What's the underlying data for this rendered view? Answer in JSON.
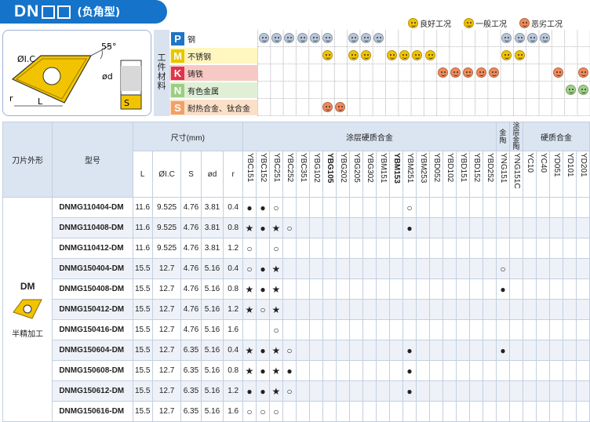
{
  "header": {
    "code": "DN",
    "subtitle": "(负角型)"
  },
  "legend": [
    {
      "label": "良好工况",
      "icon": "face-good"
    },
    {
      "label": "一般工况",
      "icon": "face-neutral"
    },
    {
      "label": "恶劣工况",
      "icon": "face-bad"
    }
  ],
  "diagram": {
    "angle": "55°",
    "ic": "ØI.C",
    "d": "ød",
    "r": "r",
    "L": "L",
    "S": "S"
  },
  "materials_header": "工件材料",
  "materials": [
    {
      "letter": "P",
      "name": "钢",
      "color": "#1f74c6",
      "bg": "#ffffff",
      "faces": [
        {
          "col": 0,
          "t": "gray"
        },
        {
          "col": 1,
          "t": "gray"
        },
        {
          "col": 2,
          "t": "gray"
        },
        {
          "col": 3,
          "t": "gray"
        },
        {
          "col": 4,
          "t": "gray"
        },
        {
          "col": 5,
          "t": "gray"
        },
        {
          "col": 7,
          "t": "gray"
        },
        {
          "col": 8,
          "t": "gray"
        },
        {
          "col": 9,
          "t": "gray"
        },
        {
          "col": 19,
          "t": "gray"
        },
        {
          "col": 20,
          "t": "gray"
        },
        {
          "col": 21,
          "t": "gray"
        },
        {
          "col": 22,
          "t": "gray"
        }
      ]
    },
    {
      "letter": "M",
      "name": "不锈钢",
      "color": "#e7c600",
      "bg": "#fff6c0",
      "faces": [
        {
          "col": 5,
          "t": "good"
        },
        {
          "col": 7,
          "t": "good"
        },
        {
          "col": 8,
          "t": "good"
        },
        {
          "col": 10,
          "t": "good"
        },
        {
          "col": 11,
          "t": "good"
        },
        {
          "col": 12,
          "t": "good"
        },
        {
          "col": 13,
          "t": "good"
        },
        {
          "col": 19,
          "t": "good"
        },
        {
          "col": 20,
          "t": "good"
        }
      ]
    },
    {
      "letter": "K",
      "name": "铸铁",
      "color": "#e0344a",
      "bg": "#f7c9c4",
      "faces": [
        {
          "col": 14,
          "t": "bad"
        },
        {
          "col": 15,
          "t": "bad"
        },
        {
          "col": 16,
          "t": "bad"
        },
        {
          "col": 17,
          "t": "bad"
        },
        {
          "col": 18,
          "t": "bad"
        },
        {
          "col": 23,
          "t": "bad"
        },
        {
          "col": 25,
          "t": "bad"
        }
      ]
    },
    {
      "letter": "N",
      "name": "有色金属",
      "color": "#9ccd84",
      "bg": "#dff0d6",
      "faces": [
        {
          "col": 24,
          "t": "green"
        },
        {
          "col": 25,
          "t": "green"
        }
      ]
    },
    {
      "letter": "S",
      "name": "耐热合金、钛合金",
      "color": "#f1a168",
      "bg": "#fbe0c8",
      "faces": [
        {
          "col": 5,
          "t": "bad"
        },
        {
          "col": 6,
          "t": "bad"
        }
      ]
    }
  ],
  "table": {
    "h_shape": "刀片外形",
    "h_model": "型号",
    "h_dims": "尺寸(mm)",
    "h_coated": "涂层硬质合金",
    "h_cermet": "金陶",
    "h_coated_cermet": "涂层金陶",
    "h_carbide": "硬质合金",
    "dim_cols": [
      "L",
      "ØI.C",
      "S",
      "ød",
      "r"
    ],
    "grades": [
      "YBC151",
      "YBC152",
      "YBC251",
      "YBC252",
      "YBC351",
      "YBG102",
      "YBG105",
      "YBG202",
      "YBG205",
      "YBG302",
      "YBM151",
      "YBM153",
      "YBM251",
      "YBM253",
      "YBD052",
      "YBD102",
      "YBD151",
      "YBD152",
      "YBD252",
      "YNG151",
      "YNG151C",
      "YC10",
      "YC40",
      "YD051",
      "YD101",
      "YD201"
    ],
    "bold_grades": [
      "YBG105",
      "YBM153"
    ],
    "shape_label": "DM",
    "shape_desc": "半精加工",
    "rows": [
      {
        "model": "DNMG110404-DM",
        "L": "11.6",
        "ic": "9.525",
        "S": "4.76",
        "d": "3.81",
        "r": "0.4",
        "marks": {
          "0": "●",
          "1": "●",
          "2": "○",
          "12": "○"
        }
      },
      {
        "model": "DNMG110408-DM",
        "L": "11.6",
        "ic": "9.525",
        "S": "4.76",
        "d": "3.81",
        "r": "0.8",
        "marks": {
          "0": "★",
          "1": "●",
          "2": "★",
          "3": "○",
          "12": "●"
        }
      },
      {
        "model": "DNMG110412-DM",
        "L": "11.6",
        "ic": "9.525",
        "S": "4.76",
        "d": "3.81",
        "r": "1.2",
        "marks": {
          "0": "○",
          "2": "○"
        }
      },
      {
        "model": "DNMG150404-DM",
        "L": "15.5",
        "ic": "12.7",
        "S": "4.76",
        "d": "5.16",
        "r": "0.4",
        "marks": {
          "0": "○",
          "1": "●",
          "2": "★",
          "19": "○"
        }
      },
      {
        "model": "DNMG150408-DM",
        "L": "15.5",
        "ic": "12.7",
        "S": "4.76",
        "d": "5.16",
        "r": "0.8",
        "marks": {
          "0": "★",
          "1": "●",
          "2": "★",
          "19": "●"
        }
      },
      {
        "model": "DNMG150412-DM",
        "L": "15.5",
        "ic": "12.7",
        "S": "4.76",
        "d": "5.16",
        "r": "1.2",
        "marks": {
          "0": "★",
          "1": "○",
          "2": "★"
        }
      },
      {
        "model": "DNMG150416-DM",
        "L": "15.5",
        "ic": "12.7",
        "S": "4.76",
        "d": "5.16",
        "r": "1.6",
        "marks": {
          "2": "○"
        }
      },
      {
        "model": "DNMG150604-DM",
        "L": "15.5",
        "ic": "12.7",
        "S": "6.35",
        "d": "5.16",
        "r": "0.4",
        "marks": {
          "0": "★",
          "1": "●",
          "2": "★",
          "3": "○",
          "12": "●",
          "19": "●"
        }
      },
      {
        "model": "DNMG150608-DM",
        "L": "15.5",
        "ic": "12.7",
        "S": "6.35",
        "d": "5.16",
        "r": "0.8",
        "marks": {
          "0": "★",
          "1": "●",
          "2": "★",
          "3": "●",
          "12": "●"
        }
      },
      {
        "model": "DNMG150612-DM",
        "L": "15.5",
        "ic": "12.7",
        "S": "6.35",
        "d": "5.16",
        "r": "1.2",
        "marks": {
          "0": "●",
          "1": "●",
          "2": "★",
          "3": "○",
          "12": "●"
        }
      },
      {
        "model": "DNMG150616-DM",
        "L": "15.5",
        "ic": "12.7",
        "S": "6.35",
        "d": "5.16",
        "r": "1.6",
        "marks": {
          "0": "○",
          "1": "○",
          "2": "○"
        }
      }
    ]
  }
}
